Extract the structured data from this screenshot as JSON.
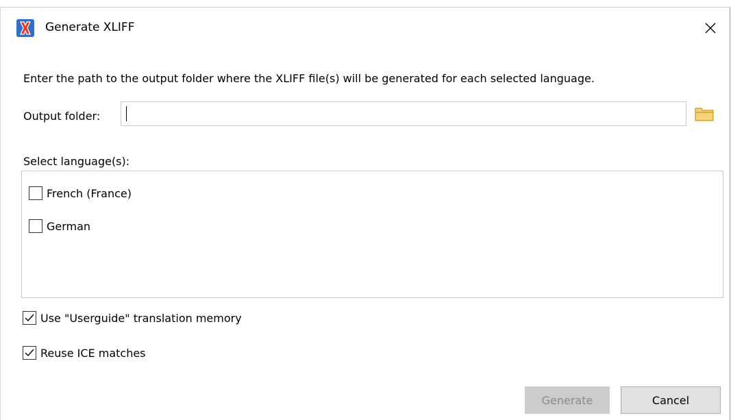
{
  "dialog": {
    "title": "Generate XLIFF",
    "app_icon": "x-logo-icon",
    "close_icon": "close-icon"
  },
  "instruction": "Enter the path to the output folder where the XLIFF file(s) will be generated for each selected language.",
  "output": {
    "label": "Output folder:",
    "value": "",
    "browse_icon": "folder-icon"
  },
  "languages": {
    "label": "Select language(s):",
    "items": [
      {
        "label": "French (France)",
        "checked": false
      },
      {
        "label": "German",
        "checked": false
      }
    ]
  },
  "options": {
    "translation_memory": {
      "label": "Use \"Userguide\" translation memory",
      "checked": true
    },
    "reuse_ice": {
      "label": "Reuse ICE matches",
      "checked": true
    }
  },
  "buttons": {
    "generate": "Generate",
    "generate_enabled": false,
    "cancel": "Cancel"
  },
  "colors": {
    "accent": "#2f6fc5",
    "folder": "#e8b32c",
    "disabled_bg": "#cccccc"
  }
}
